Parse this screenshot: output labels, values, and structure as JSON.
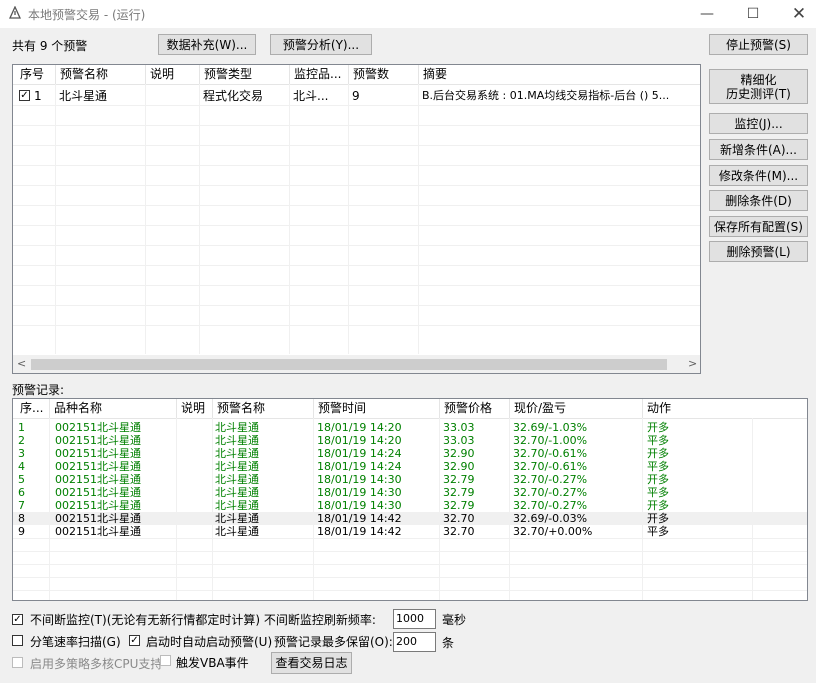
{
  "window": {
    "title": "本地预警交易 - (运行)"
  },
  "top": {
    "count_label": "共有 9 个预警",
    "data_fill_button": "数据补充(W)...",
    "analysis_button": "预警分析(Y)..."
  },
  "right_buttons": {
    "stop": "停止预警(S)",
    "refine_line1": "精细化",
    "refine_line2": "历史测评(T)",
    "monitor": "监控(J)...",
    "add_condition": "新增条件(A)...",
    "edit_condition": "修改条件(M)...",
    "delete_condition": "删除条件(D)",
    "save_all": "保存所有配置(S)",
    "delete_alert": "删除预警(L)"
  },
  "alerts_table": {
    "headers": [
      "序号",
      "预警名称",
      "说明",
      "预警类型",
      "监控品...",
      "预警数",
      "摘要"
    ],
    "rows": [
      {
        "checked": true,
        "index": "1",
        "name": "北斗星通",
        "desc": "",
        "type": "程式化交易",
        "monitor": "北斗...",
        "count": "9",
        "summary": "B.后台交易系统 : 01.MA均线交易指标-后台 () 5..."
      }
    ]
  },
  "records_label": "预警记录:",
  "records_table": {
    "headers": [
      "序...",
      "品种名称",
      "说明",
      "预警名称",
      "预警时间",
      "预警价格",
      "现价/盈亏",
      "动作"
    ],
    "rows": [
      {
        "seq": "1",
        "code": "002151",
        "name": "北斗星通",
        "desc": "",
        "alert": "北斗星通",
        "time": "18/01/19 14:20",
        "price": "33.03",
        "pnl": "32.69/-1.03%",
        "action": "开多",
        "color": "#008000"
      },
      {
        "seq": "2",
        "code": "002151",
        "name": "北斗星通",
        "desc": "",
        "alert": "北斗星通",
        "time": "18/01/19 14:20",
        "price": "33.03",
        "pnl": "32.70/-1.00%",
        "action": "平多",
        "color": "#008000"
      },
      {
        "seq": "3",
        "code": "002151",
        "name": "北斗星通",
        "desc": "",
        "alert": "北斗星通",
        "time": "18/01/19 14:24",
        "price": "32.90",
        "pnl": "32.70/-0.61%",
        "action": "开多",
        "color": "#008000"
      },
      {
        "seq": "4",
        "code": "002151",
        "name": "北斗星通",
        "desc": "",
        "alert": "北斗星通",
        "time": "18/01/19 14:24",
        "price": "32.90",
        "pnl": "32.70/-0.61%",
        "action": "平多",
        "color": "#008000"
      },
      {
        "seq": "5",
        "code": "002151",
        "name": "北斗星通",
        "desc": "",
        "alert": "北斗星通",
        "time": "18/01/19 14:30",
        "price": "32.79",
        "pnl": "32.70/-0.27%",
        "action": "开多",
        "color": "#008000"
      },
      {
        "seq": "6",
        "code": "002151",
        "name": "北斗星通",
        "desc": "",
        "alert": "北斗星通",
        "time": "18/01/19 14:30",
        "price": "32.79",
        "pnl": "32.70/-0.27%",
        "action": "平多",
        "color": "#008000"
      },
      {
        "seq": "7",
        "code": "002151",
        "name": "北斗星通",
        "desc": "",
        "alert": "北斗星通",
        "time": "18/01/19 14:30",
        "price": "32.79",
        "pnl": "32.70/-0.27%",
        "action": "开多",
        "color": "#008000"
      },
      {
        "seq": "8",
        "code": "002151",
        "name": "北斗星通",
        "desc": "",
        "alert": "北斗星通",
        "time": "18/01/19 14:42",
        "price": "32.70",
        "pnl": "32.69/-0.03%",
        "action": "开多",
        "color": "#000000"
      },
      {
        "seq": "9",
        "code": "002151",
        "name": "北斗星通",
        "desc": "",
        "alert": "北斗星通",
        "time": "18/01/19 14:42",
        "price": "32.70",
        "pnl": "32.70/+0.00%",
        "action": "平多",
        "color": "#000000"
      }
    ]
  },
  "options": {
    "continuous_label": "不间断监控(T)(无论有无新行情都定时计算) 不间断监控刷新频率:",
    "continuous_checked": true,
    "refresh_value": "1000",
    "refresh_unit": "毫秒",
    "tick_label": "分笔速率扫描(G)",
    "tick_checked": false,
    "autostart_label": "启动时自动启动预警(U)",
    "autostart_checked": true,
    "keep_label": "预警记录最多保留(O):",
    "keep_value": "200",
    "keep_unit": "条",
    "multicore_label": "启用多策略多核CPU支持",
    "multicore_checked": false,
    "vba_label": "触发VBA事件",
    "vba_checked": false,
    "log_button": "查看交易日志"
  }
}
